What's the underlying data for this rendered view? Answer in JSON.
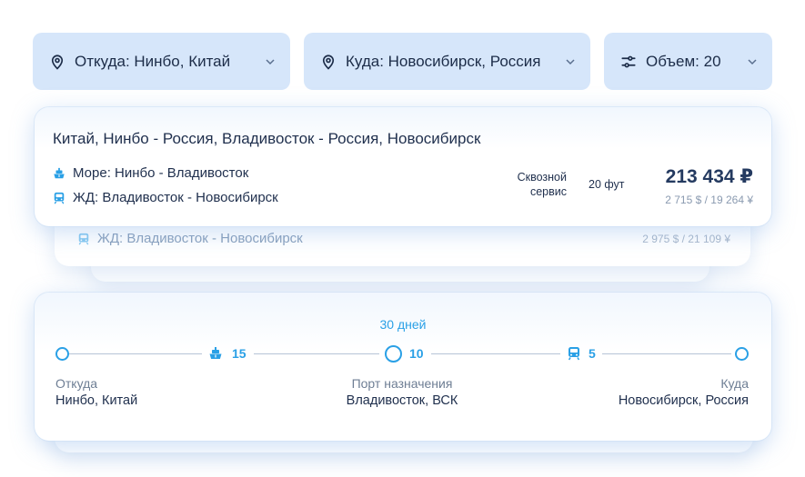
{
  "filters": {
    "from": {
      "label": "Откуда: Нинбо, Китай",
      "icon": "location-pin-icon"
    },
    "to": {
      "label": "Куда: Новосибирск, Россия",
      "icon": "location-pin-icon"
    },
    "volume": {
      "label": "Объем: 20",
      "icon": "sliders-icon"
    }
  },
  "route_card": {
    "title": "Китай, Нинбо - Россия, Владивосток - Россия, Новосибирск",
    "segments": [
      {
        "icon": "ship-icon",
        "label": "Море: Нинбо - Владивосток"
      },
      {
        "icon": "train-icon",
        "label": "ЖД: Владивосток - Новосибирск"
      }
    ],
    "service": "Сквозной сервис",
    "container": "20 фут",
    "price": "213 434 ₽",
    "sub_price": "2 715 $ / 19 264 ¥"
  },
  "route_card_behind": {
    "segment": {
      "icon": "train-icon",
      "label": "ЖД: Владивосток - Новосибирск"
    },
    "sub_price": "2 975 $ / 21 109 ¥"
  },
  "timeline": {
    "total": "30 дней",
    "legs": [
      {
        "icon": "ship-icon",
        "days": "15"
      },
      {
        "icon": "train-icon",
        "days": "5"
      }
    ],
    "middle_days": "10",
    "points": [
      {
        "label": "Откуда",
        "value": "Нинбо, Китай"
      },
      {
        "label": "Порт назначения",
        "value": "Владивосток, ВСК"
      },
      {
        "label": "Куда",
        "value": "Новосибирск, Россия"
      }
    ]
  },
  "colors": {
    "accent": "#2aa0e6",
    "filter_bg": "#d6e6fa",
    "text_dark": "#1f2f4d",
    "text_muted": "#8a9ab0"
  }
}
